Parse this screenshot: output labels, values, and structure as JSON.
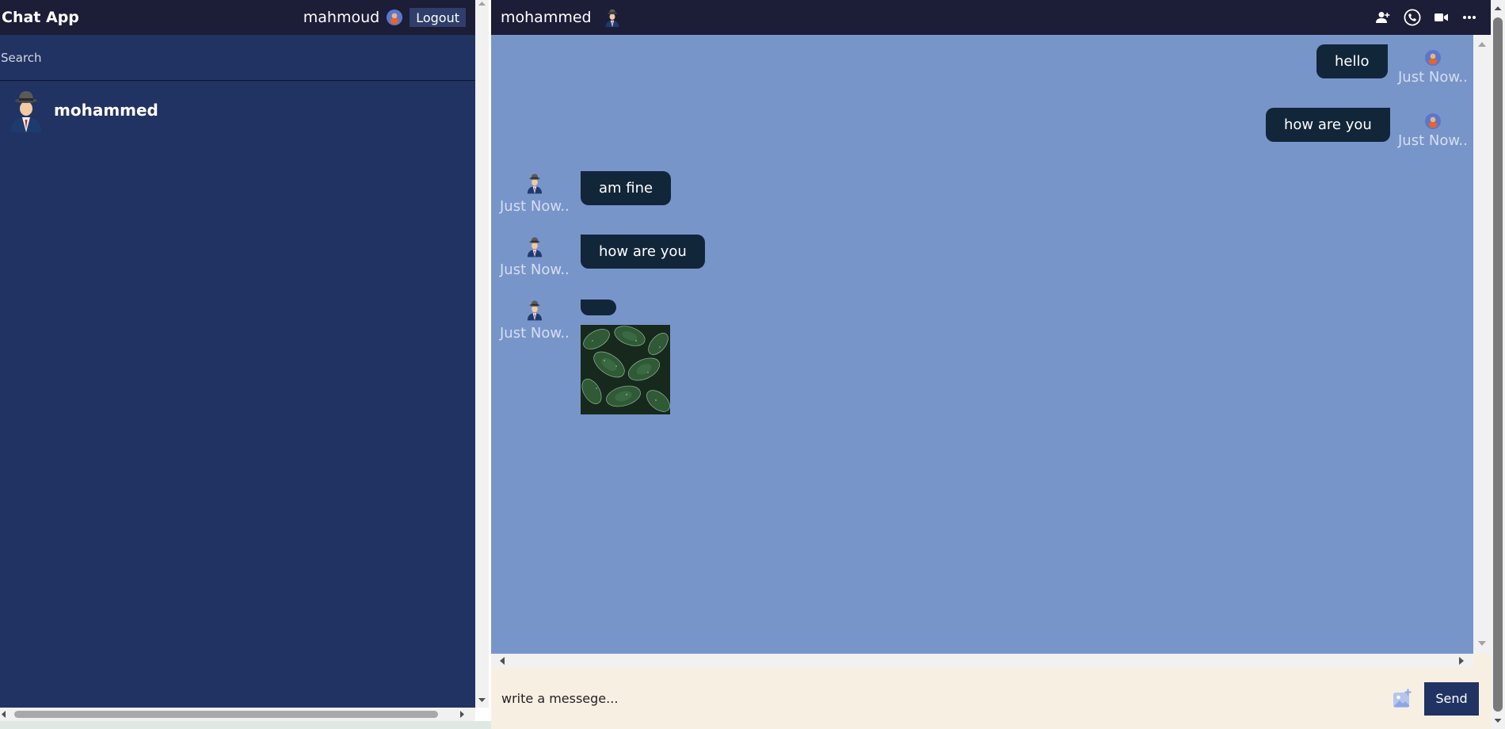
{
  "sidebar": {
    "logo": "Chat App",
    "current_user": {
      "name": "mahmoud",
      "avatar": "user-avatar-icon"
    },
    "logout_label": "Logout",
    "search_placeholder": "Search",
    "chats": [
      {
        "name": "mohammed",
        "avatar": "man-in-hat-avatar"
      }
    ]
  },
  "chat": {
    "contact_name": "mohammed",
    "contact_avatar": "man-in-hat-avatar",
    "icons": [
      "add-user-icon",
      "phone-icon",
      "video-camera-icon",
      "more-icon"
    ],
    "messages": [
      {
        "from": "owner",
        "text": "hello",
        "time": "Just Now.."
      },
      {
        "from": "owner",
        "text": "how are you",
        "time": "Just Now.."
      },
      {
        "from": "other",
        "text": "am fine",
        "time": "Just Now.."
      },
      {
        "from": "other",
        "text": "how are you",
        "time": "Just Now.."
      },
      {
        "from": "other",
        "text": "",
        "time": "Just Now..",
        "image": "leaf-photo"
      }
    ],
    "input_placeholder": "write a messege...",
    "attach_icon": "image-attach-icon",
    "send_label": "Send"
  },
  "colors": {
    "nav": "#1c1d36",
    "sidebar": "#213362",
    "messages_bg": "#7895ca",
    "bubble": "#12263a",
    "input_bg": "#f8efe3"
  }
}
